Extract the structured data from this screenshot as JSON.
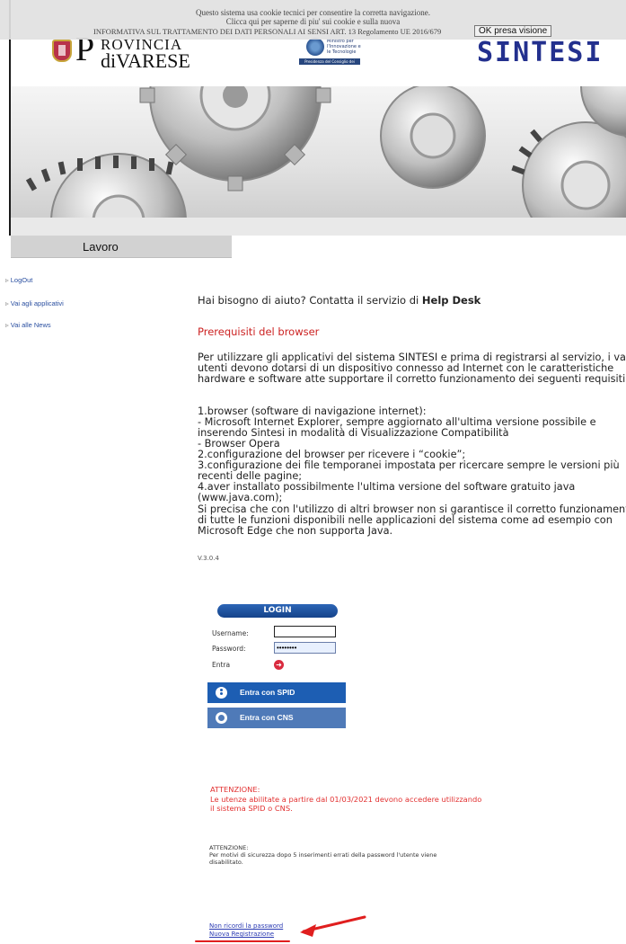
{
  "cookie_banner": {
    "line1": "Questo sistema usa cookie tecnici per consentire la corretta navigazione.",
    "line2": "Clicca qui per saperne di piu' sui cookie e sulla nuova",
    "line3": "INFORMATIVA SUL TRATTAMENTO DEI DATI PERSONALI AI SENSI ART. 13 Regolamento UE 2016/679",
    "ok_button": "OK presa visione"
  },
  "header": {
    "province_big_letter": "P",
    "province_line1": "ROVINCIA",
    "province_line2": "diVARESE",
    "ministry_text": "Ministro per l'Innovazione e le Tecnologie",
    "ministry_bar": "Presidenza del Consiglio dei Ministri",
    "sintesi_logo": "SINTESI"
  },
  "section_tab": {
    "label": "Lavoro"
  },
  "sidebar": {
    "items": [
      {
        "label": "LogOut"
      },
      {
        "label": "Vai agli applicativi"
      },
      {
        "label": "Vai alle News"
      }
    ]
  },
  "main": {
    "help_prefix": "Hai bisogno di aiuto?  Contatta il servizio di ",
    "help_bold": "Help Desk",
    "prereq_heading": "Prerequisiti del browser",
    "intro_lines": [
      "Per utilizzare gli applicativi del sistema SINTESI e prima di registrarsi al servizio, i vari",
      "utenti devono dotarsi di un dispositivo connesso ad Internet con le caratteristiche",
      "hardware e software atte supportare il corretto funzionamento dei seguenti requisiti:"
    ],
    "requirement_lines": [
      "1.browser (software di navigazione internet):",
      "- Microsoft Internet Explorer, sempre aggiornato all'ultima versione possibile e",
      "inserendo Sintesi in modalità di Visualizzazione Compatibilità",
      "- Browser Opera",
      "2.configurazione del browser per ricevere i “cookie”;",
      "3.configurazione dei file temporanei impostata per ricercare sempre le versioni più",
      "recenti delle pagine;",
      "4.aver installato possibilmente l'ultima versione del software gratuito java",
      "(www.java.com);"
    ],
    "note_lines": [
      "Si precisa che con l'utilizzo di altri browser non si garantisce il corretto funzionamento",
      "di tutte le funzioni disponibili nelle applicazioni del sistema come ad esempio con",
      "Microsoft Edge che non supporta Java."
    ],
    "version": "V.3.0.4"
  },
  "login": {
    "header": "LOGIN",
    "username_label": "Username:",
    "username_value": "",
    "password_label": "Password:",
    "password_value": "••••••••",
    "entra_label": "Entra",
    "entra_icon": "login-arrow-icon",
    "spid_button": "Entra con SPID",
    "cns_button": "Entra con CNS"
  },
  "attention_red": {
    "lines": [
      "ATTENZIONE:",
      "Le utenze abilitate a partire dal 01/03/2021 devono accedere utilizzando",
      "il sistema SPID o CNS."
    ]
  },
  "attention_black": {
    "lines": [
      "ATTENZIONE:",
      "Per motivi di sicurezza dopo 5 inserimenti errati della password l'utente viene",
      "disabilitato."
    ]
  },
  "links": {
    "forgot_password": "Non ricordi la password",
    "new_registration": "Nuova Registrazione"
  },
  "colors": {
    "accent_blue": "#1d5eb3",
    "warning_red": "#e23131",
    "sintesi_blue": "#23308e",
    "annotation_red": "#e01e1e"
  }
}
